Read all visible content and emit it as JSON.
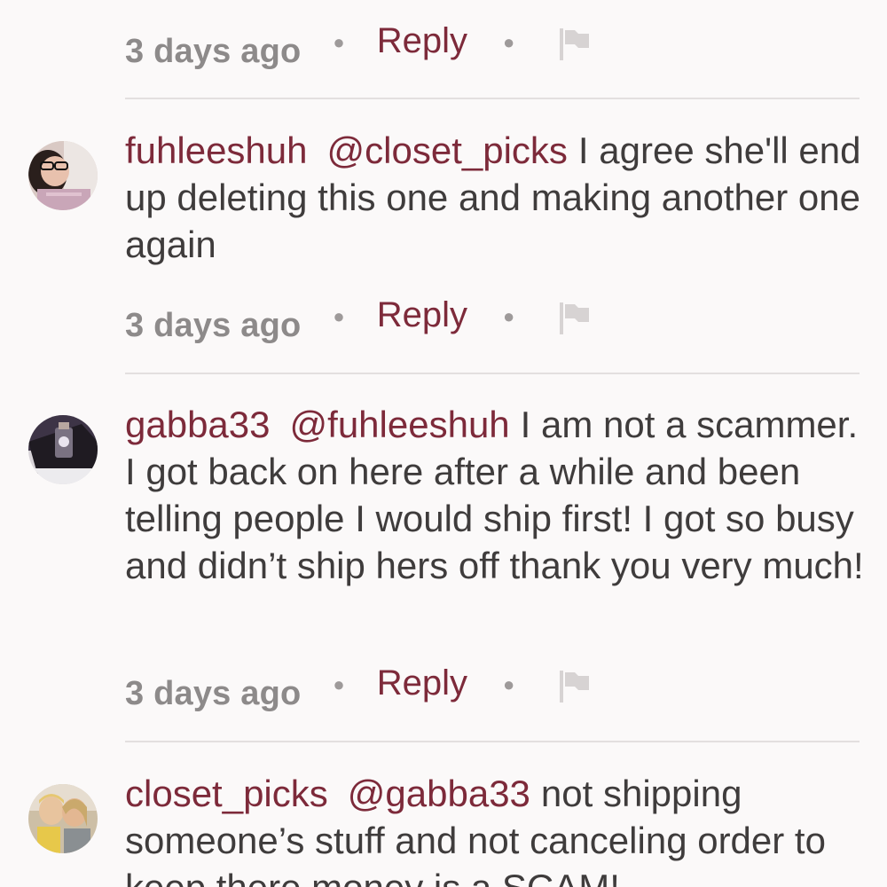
{
  "comments": [
    {
      "timestamp": "3 days ago",
      "reply_label": "Reply"
    },
    {
      "username": "fuhleeshuh",
      "mention": "@closet_picks",
      "text": "I agree she'll end up deleting this one and making another one again",
      "timestamp": "3 days ago",
      "reply_label": "Reply"
    },
    {
      "username": "gabba33",
      "mention": "@fuhleeshuh",
      "text": "I am not a scammer. I got back on here after a while and been telling people I would ship first! I got so busy and didn’t ship hers off thank you very much!",
      "timestamp": "3 days ago",
      "reply_label": "Reply"
    },
    {
      "username": "closet_picks",
      "mention": "@gabba33",
      "text": "not shipping someone’s stuff and not canceling order to keep there money is a SCAM!"
    }
  ],
  "icons": {
    "separator": "dot-icon",
    "report": "flag-icon"
  },
  "colors": {
    "accent": "#7d2a3a",
    "text": "#3f3c3c",
    "muted": "#8d8a8a",
    "background": "#fbf9f9",
    "divider": "#e3dfdf"
  }
}
